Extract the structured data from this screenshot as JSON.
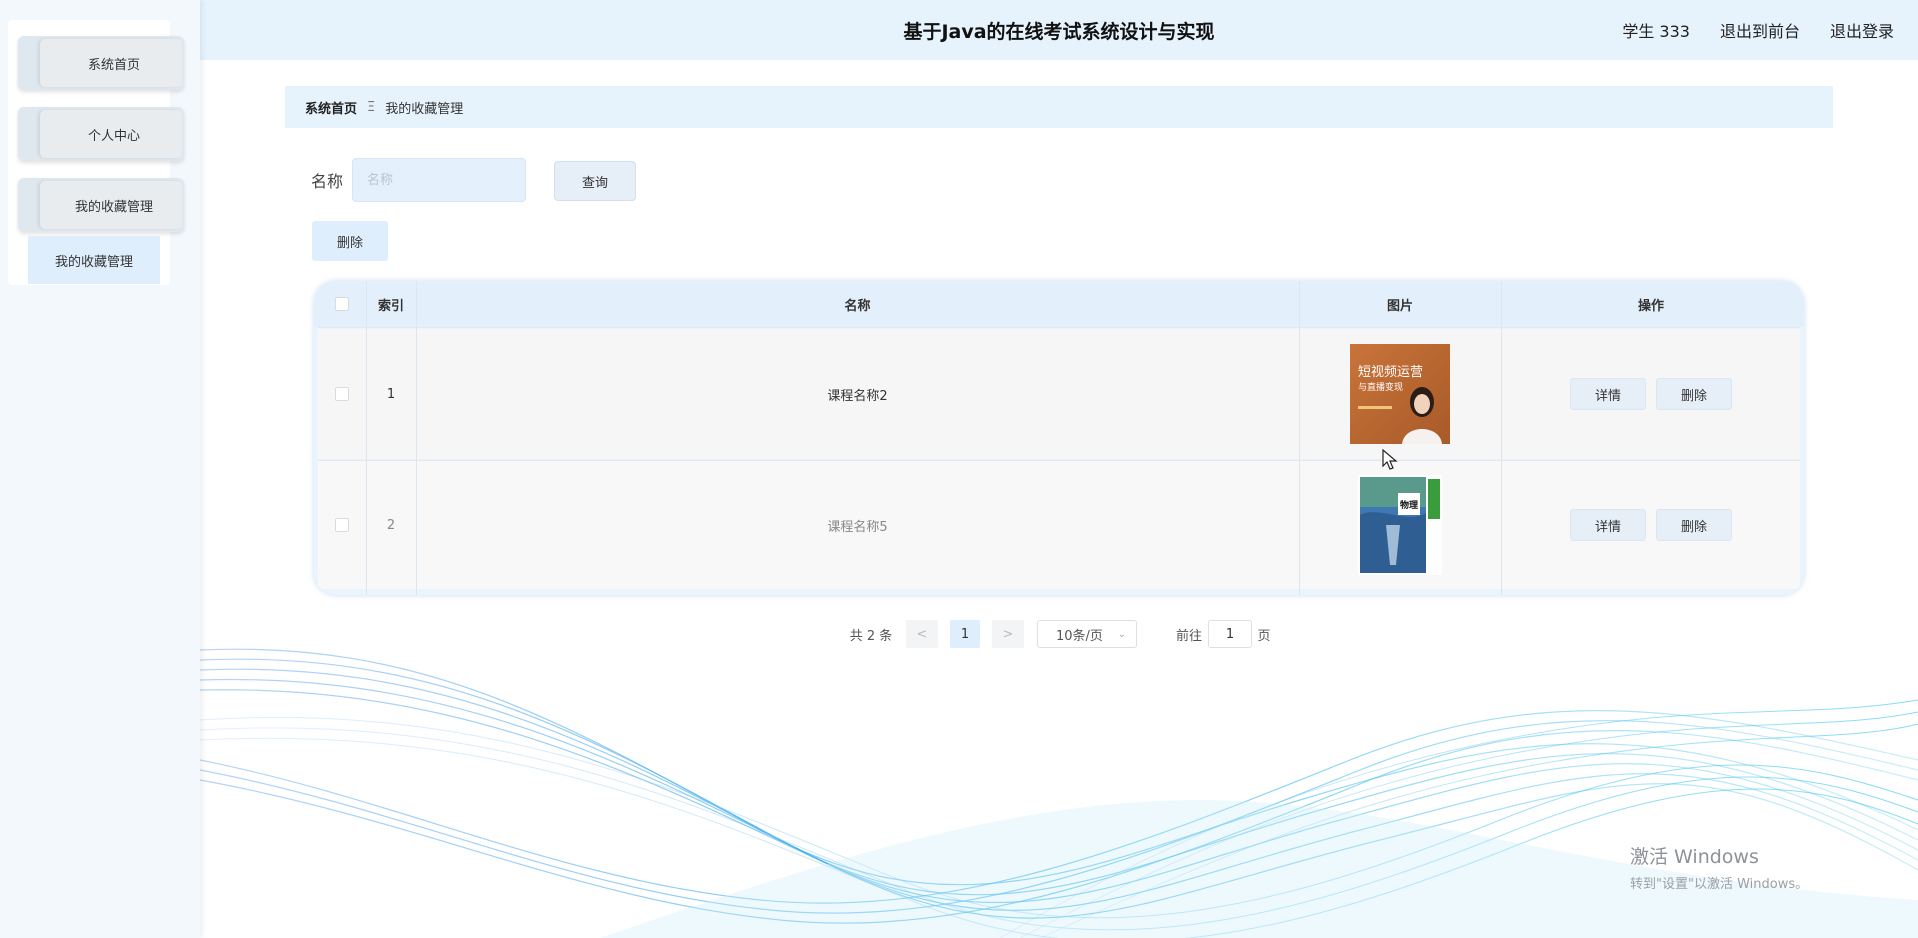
{
  "header": {
    "title": "基于Java的在线考试系统设计与实现",
    "user": "学生 333",
    "back_to_front": "退出到前台",
    "logout": "退出登录"
  },
  "sidebar": {
    "items": [
      {
        "label": "系统首页"
      },
      {
        "label": "个人中心"
      },
      {
        "label": "我的收藏管理"
      }
    ],
    "submenu": {
      "label": "我的收藏管理"
    }
  },
  "breadcrumb": {
    "home": "系统首页",
    "separator": "Ξ",
    "current": "我的收藏管理"
  },
  "search": {
    "label": "名称",
    "placeholder": "名称",
    "query_button": "查询"
  },
  "actions": {
    "delete_button": "删除"
  },
  "table": {
    "headers": {
      "index": "索引",
      "name": "名称",
      "image": "图片",
      "ops": "操作"
    },
    "rows": [
      {
        "index": "1",
        "name": "课程名称2",
        "image_title": "短视频运营",
        "image_subtitle": "与直播变现",
        "detail": "详情",
        "delete": "删除"
      },
      {
        "index": "2",
        "name": "课程名称5",
        "image_title": "物理",
        "image_subtitle": "",
        "detail": "详情",
        "delete": "删除"
      }
    ]
  },
  "pagination": {
    "total": "共 2 条",
    "prev": "<",
    "page": "1",
    "next": ">",
    "page_size": "10条/页",
    "goto_label": "前往",
    "goto_value": "1",
    "page_suffix": "页"
  },
  "watermark": {
    "line1": "激活 Windows",
    "line2": "转到\"设置\"以激活 Windows。"
  },
  "colors": {
    "accent": "#deeefc",
    "header_bg": "#e6f2fc",
    "wave": "#3fb7e6"
  }
}
